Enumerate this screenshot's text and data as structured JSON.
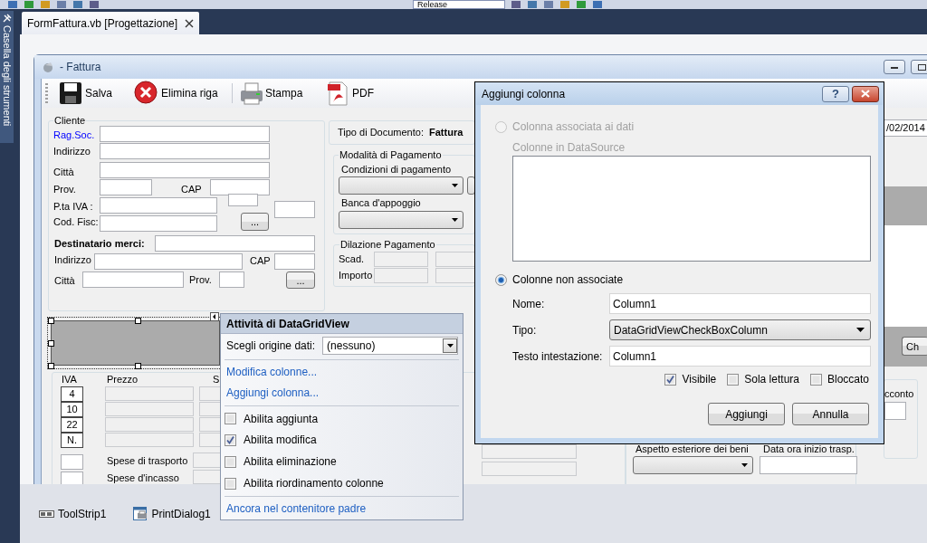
{
  "ide": {
    "configuration": "Release",
    "side_tab": "Casella degli strumenti",
    "document_tab": {
      "label": "FormFattura.vb [Progettazione]",
      "selected": true
    }
  },
  "form": {
    "title": "- Fattura",
    "toolbar": [
      {
        "kind": "save",
        "label": "Salva"
      },
      {
        "kind": "delete",
        "label": "Elimina riga"
      },
      {
        "kind": "print",
        "label": "Stampa"
      },
      {
        "kind": "pdf",
        "label": "PDF"
      }
    ],
    "cliente": {
      "title": "Cliente",
      "labels": [
        {
          "text": "Rag.Soc.",
          "kind": "link"
        },
        {
          "text": "Indirizzo",
          "kind": "plain"
        },
        {
          "text": "Città",
          "kind": "plain"
        },
        {
          "text": "Prov.",
          "kind": "plain"
        },
        {
          "text": "CAP",
          "kind": "plain"
        },
        {
          "text": "P.ta  IVA :",
          "kind": "plain"
        },
        {
          "text": "Cod. Fisc:",
          "kind": "plain"
        },
        {
          "text": "Destinatario merci:",
          "kind": "bold"
        },
        {
          "text": "Indirizzo",
          "kind": "plain"
        },
        {
          "text": "CAP",
          "kind": "plain"
        },
        {
          "text": "Città",
          "kind": "plain"
        },
        {
          "text": "Prov.",
          "kind": "plain"
        }
      ],
      "buttons": [
        "...",
        "..."
      ]
    },
    "documento": {
      "label": "Tipo di Documento:",
      "value": "Fattura"
    },
    "pagamento": {
      "title": "Modalità di Pagamento",
      "labels": [
        "Condizioni di pagamento",
        "Banca d'appoggio"
      ]
    },
    "dilazione": {
      "title": "Dilazione Pagamento",
      "labels": [
        "Scad.",
        "Importo"
      ]
    },
    "totali": {
      "columns": [
        "IVA",
        "Prezzo",
        "S"
      ],
      "rates": [
        "4",
        "10",
        "22",
        "N."
      ],
      "spese": [
        "Spese di trasporto",
        "Spese d'incasso"
      ]
    },
    "date_value": "/02/2014",
    "side_button": "Ch",
    "acconto_label": "cconto",
    "trasporto": {
      "labels": [
        "Aspetto esteriore dei beni",
        "Data ora inizio trasp."
      ]
    }
  },
  "smart_tag": {
    "title": "Attività di DataGridView",
    "data_source": {
      "label": "Scegli origine dati:",
      "value": "(nessuno)"
    },
    "links": [
      "Modifica colonne...",
      "Aggiungi colonna..."
    ],
    "options": [
      {
        "label": "Abilita aggiunta",
        "checked": false
      },
      {
        "label": "Abilita modifica",
        "checked": true
      },
      {
        "label": "Abilita eliminazione",
        "checked": false
      },
      {
        "label": "Abilita riordinamento colonne",
        "checked": false
      }
    ],
    "footer_link": "Ancora nel contenitore padre"
  },
  "dialog": {
    "title": "Aggiungi colonna",
    "help_button": "?",
    "sources": [
      {
        "label": "Colonna associata ai dati",
        "selected": false,
        "disabled": true
      },
      {
        "label": "Colonne non associate",
        "selected": true,
        "disabled": false
      }
    ],
    "datasource_label": "Colonne in DataSource",
    "fields": [
      {
        "kind": "text",
        "label": "Nome:",
        "value": "Column1"
      },
      {
        "kind": "combo",
        "label": "Tipo:",
        "value": "DataGridViewCheckBoxColumn"
      },
      {
        "kind": "text",
        "label": "Testo intestazione:",
        "value": "Column1"
      }
    ],
    "flags": [
      {
        "label": "Visibile",
        "checked": true
      },
      {
        "label": "Sola lettura",
        "checked": false
      },
      {
        "label": "Bloccato",
        "checked": false
      }
    ],
    "buttons": [
      "Aggiungi",
      "Annulla"
    ]
  },
  "component_tray": [
    {
      "kind": "toolstrip",
      "label": "ToolStrip1"
    },
    {
      "kind": "print_dialog",
      "label": "PrintDialog1"
    }
  ]
}
